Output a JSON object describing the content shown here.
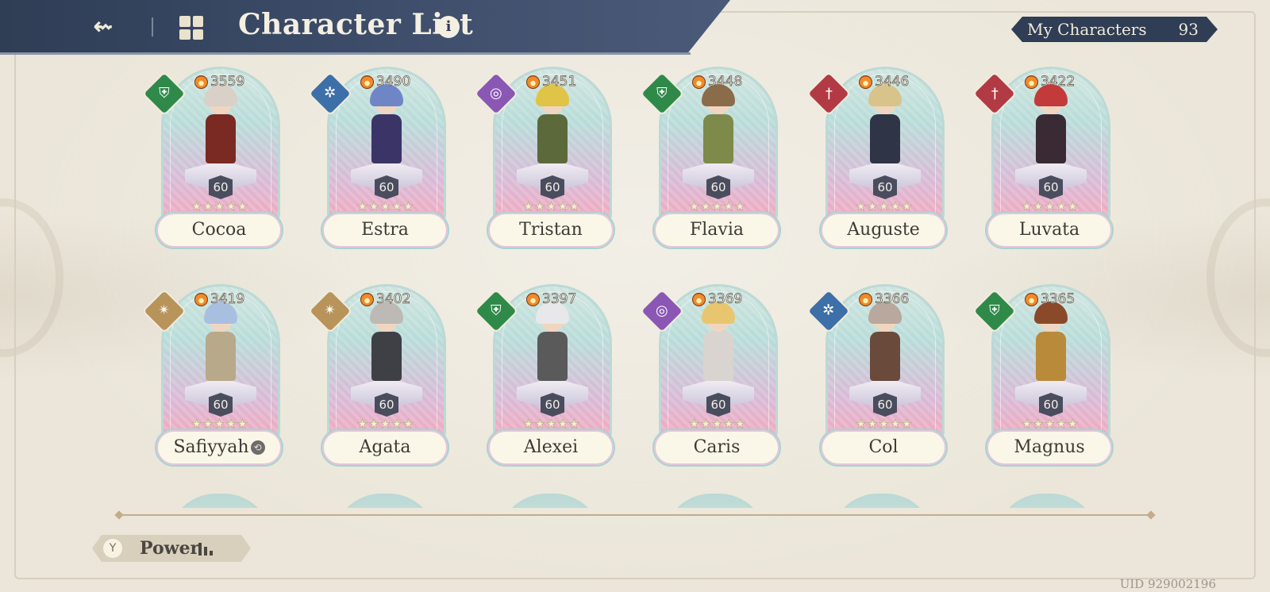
{
  "header": {
    "title": "Character List",
    "info_icon": "i",
    "back_icon": "back-arrow-icon",
    "grid_icon": "grid-icon"
  },
  "my_characters": {
    "label": "My Characters",
    "count": "93"
  },
  "characters": [
    {
      "name": "Cocoa",
      "power": "3559",
      "level": "60",
      "stars": "★★★★★",
      "element": "green",
      "element_icon": "⛨"
    },
    {
      "name": "Estra",
      "power": "3490",
      "level": "60",
      "stars": "★★★★★",
      "element": "blue",
      "element_icon": "✲"
    },
    {
      "name": "Tristan",
      "power": "3451",
      "level": "60",
      "stars": "★★★★★",
      "element": "purple",
      "element_icon": "◎"
    },
    {
      "name": "Flavia",
      "power": "3448",
      "level": "60",
      "stars": "★★★★★",
      "element": "green",
      "element_icon": "⛨"
    },
    {
      "name": "Auguste",
      "power": "3446",
      "level": "60",
      "stars": "★★★★★",
      "element": "red",
      "element_icon": "†"
    },
    {
      "name": "Luvata",
      "power": "3422",
      "level": "60",
      "stars": "★★★★★",
      "element": "red",
      "element_icon": "†"
    },
    {
      "name": "Safiyyah",
      "power": "3419",
      "level": "60",
      "stars": "★★★★★",
      "element": "gold",
      "element_icon": "✴",
      "name_badge": "⟲"
    },
    {
      "name": "Agata",
      "power": "3402",
      "level": "60",
      "stars": "★★★★★",
      "element": "gold",
      "element_icon": "✴"
    },
    {
      "name": "Alexei",
      "power": "3397",
      "level": "60",
      "stars": "★★★★★",
      "element": "green",
      "element_icon": "⛨"
    },
    {
      "name": "Caris",
      "power": "3369",
      "level": "60",
      "stars": "★★★★★",
      "element": "purple",
      "element_icon": "◎"
    },
    {
      "name": "Col",
      "power": "3366",
      "level": "60",
      "stars": "★★★★★",
      "element": "blue",
      "element_icon": "✲"
    },
    {
      "name": "Magnus",
      "power": "3365",
      "level": "60",
      "stars": "★★★★★",
      "element": "green",
      "element_icon": "⛨"
    }
  ],
  "sort": {
    "label": "Power",
    "filter_icon": "filter-icon",
    "funnel_glyph": "Y",
    "order_icon": "sort-bars-icon"
  },
  "uid": "UID 929002196",
  "colors": {
    "header_bg": "#2f3d55",
    "green": "#2f8a4a",
    "blue": "#3d6fa8",
    "purple": "#8a57b5",
    "red": "#b23a45",
    "gold": "#b8935a"
  }
}
